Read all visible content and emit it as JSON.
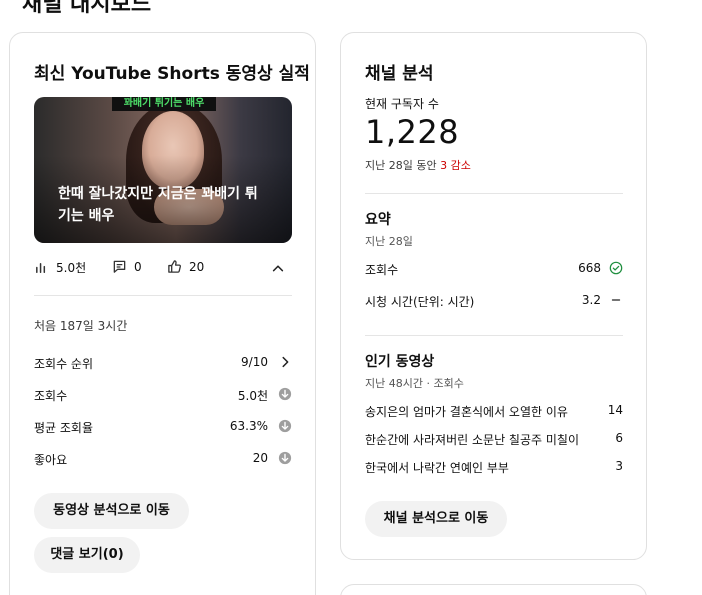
{
  "page": {
    "heading": "채널 대시보드"
  },
  "shorts_card": {
    "title": "최신 YouTube Shorts 동영상 실적",
    "thumbnail_banner": "꽈배기 튀기는 배우",
    "thumbnail_caption": "한때 잘나갔지만 지금은 꽈배기 튀기는 배우",
    "views_short": "5.0천",
    "comments": "0",
    "likes": "20",
    "first_time": "처음 187일 3시간",
    "metrics": [
      {
        "label": "조회수 순위",
        "value": "9/10",
        "icon": "chevron-right-icon"
      },
      {
        "label": "조회수",
        "value": "5.0천",
        "icon": "arrow-down-circle-icon"
      },
      {
        "label": "평균 조회율",
        "value": "63.3%",
        "icon": "arrow-down-circle-icon"
      },
      {
        "label": "좋아요",
        "value": "20",
        "icon": "arrow-down-circle-icon"
      }
    ],
    "btn_analytics": "동영상 분석으로 이동",
    "btn_comments": "댓글 보기(0)"
  },
  "analytics_card": {
    "title": "채널 분석",
    "subs_label": "현재 구독자 수",
    "subs_count": "1,228",
    "change_prefix": "지난 28일 동안",
    "change_value": "3 감소",
    "summary_title": "요약",
    "summary_period": "지난 28일",
    "summary_rows": [
      {
        "label": "조회수",
        "value": "668",
        "icon": "check-circle-icon"
      },
      {
        "label": "시청 시간(단위: 시간)",
        "value": "3.2",
        "icon": "dash-icon"
      }
    ],
    "popular_title": "인기 동영상",
    "popular_period": "지난 48시간 · 조회수",
    "popular_rows": [
      {
        "label": "송지은의 엄마가 결혼식에서 오열한 이유",
        "value": "14"
      },
      {
        "label": "한순간에 사라져버린 소문난 칠공주 미칠이",
        "value": "6"
      },
      {
        "label": "한국에서 나락간 연예인 부부",
        "value": "3"
      }
    ],
    "btn_channel": "채널 분석으로 이동"
  },
  "colors": {
    "decrease": "#cc0000",
    "check": "#1e8e3e",
    "banner_text": "#4ee06a"
  }
}
